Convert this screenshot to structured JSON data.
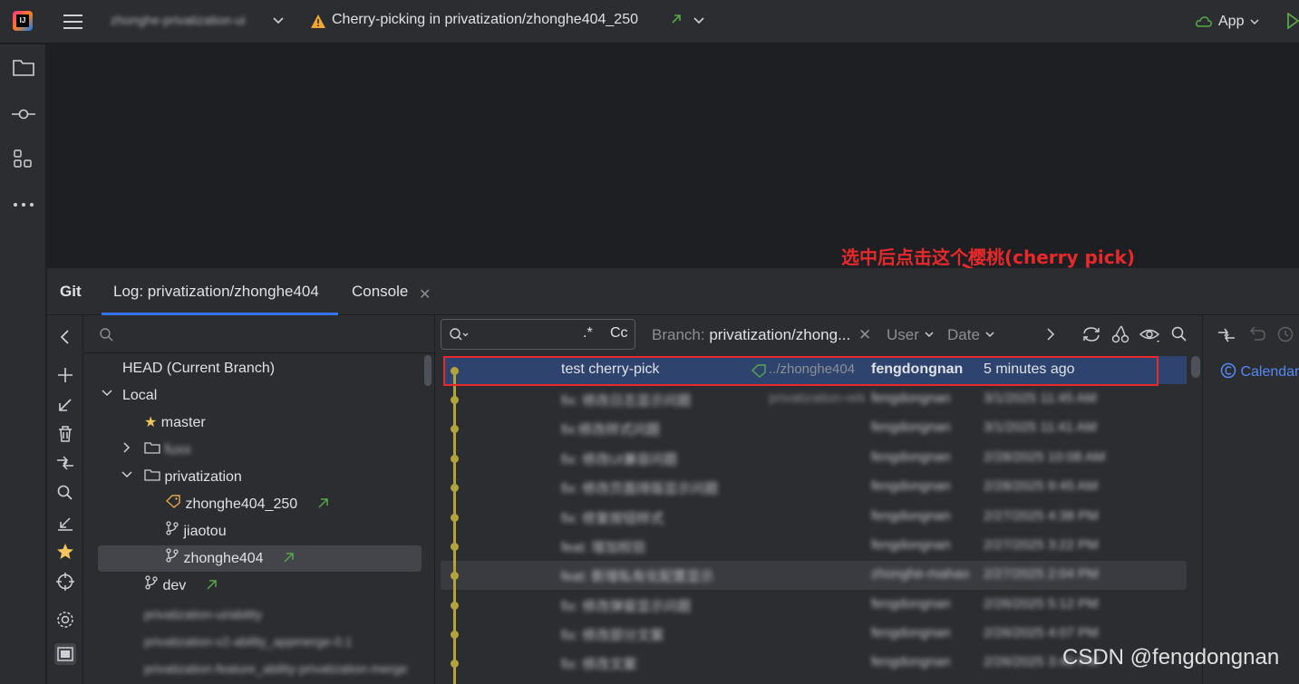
{
  "titlebar": {
    "project_name": "zhonghe-privatization-ui",
    "warning_icon": "warning-icon",
    "title": "Cherry-picking in privatization/zhonghe404_250",
    "app_label": "App"
  },
  "left_toolbar": [
    "folder-icon",
    "commit-icon",
    "structure-icon",
    "more-icon"
  ],
  "annotation": "选中后点击这个樱桃(cherry pick)",
  "tabs": {
    "git": "Git",
    "log": "Log: privatization/zhonghe404",
    "console": "Console"
  },
  "tree": {
    "head": "HEAD (Current Branch)",
    "local": "Local",
    "master": "master",
    "folder_blurred": "fuxx",
    "privatization": "privatization",
    "tag_item": "zhonghe404_250",
    "jiaotou": "jiaotou",
    "zhonghe404": "zhonghe404",
    "dev": "dev",
    "blurred_1": "privatization-ui/ability",
    "blurred_2": "privatization-v2-ability_appmerge-0.1",
    "blurred_3": "privatization-feature_ability-privatization-merge"
  },
  "log_filters": {
    "regex": ".*",
    "case": "Cc",
    "branch_label": "Branch:",
    "branch_value": "privatization/zhong...",
    "user": "User",
    "date": "Date"
  },
  "commits": [
    {
      "message": "test  cherry-pick",
      "ref": "../zhonghe404",
      "author": "fengdongnan",
      "date": "5 minutes ago",
      "selected": true
    },
    {
      "message": "fix: 修改日志显示问题",
      "ref": "privatization-release",
      "author": "fengdongnan",
      "date": "3/1/2025 11:45 AM"
    },
    {
      "message": "fix:修改样式问题",
      "ref": "",
      "author": "fengdongnan",
      "date": "3/1/2025 11:41 AM"
    },
    {
      "message": "fix: 修改UI兼容问题",
      "ref": "",
      "author": "fengdongnan",
      "date": "2/28/2025 10:08 AM"
    },
    {
      "message": "fix: 修改页面排版显示问题",
      "ref": "",
      "author": "fengdongnan",
      "date": "2/28/2025 9:45 AM"
    },
    {
      "message": "fix: 修复按钮样式",
      "ref": "",
      "author": "fengdongnan",
      "date": "2/27/2025 4:38 PM"
    },
    {
      "message": "feat: 增加校验",
      "ref": "",
      "author": "fengdongnan",
      "date": "2/27/2025 3:22 PM"
    },
    {
      "message": "feat: 新增私有化配置显示",
      "ref": "",
      "author": "zhonghe-mahao",
      "date": "2/27/2025 2:04 PM"
    },
    {
      "message": "fix: 修改弹窗显示问题",
      "ref": "",
      "author": "fengdongnan",
      "date": "2/26/2025 5:12 PM"
    },
    {
      "message": "fix: 修改部分文案",
      "ref": "",
      "author": "fengdongnan",
      "date": "2/26/2025 4:07 PM"
    },
    {
      "message": "fix: 修改文案",
      "ref": "",
      "author": "fengdongnan",
      "date": "2/26/2025 3:40 PM"
    }
  ],
  "details": {
    "file_label": "Calendar"
  },
  "watermark": "CSDN @fengdongnan"
}
